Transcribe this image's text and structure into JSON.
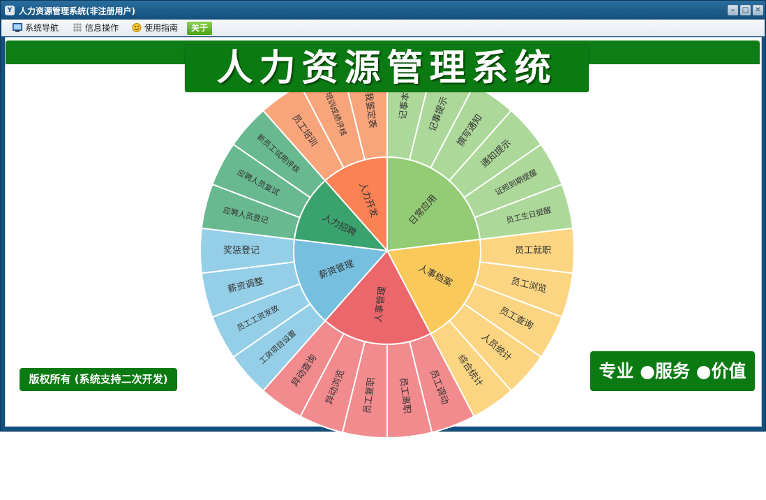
{
  "window": {
    "title": "人力资源管理系统(非注册用户)",
    "app_icon": "Y",
    "controls": {
      "minimize": "–",
      "maximize": "□",
      "close": "✕"
    }
  },
  "menu": {
    "items": [
      {
        "label": "系统导航",
        "icon": "monitor-icon"
      },
      {
        "label": "信息操作",
        "icon": "grid-icon"
      },
      {
        "label": "使用指南",
        "icon": "smiley-icon"
      },
      {
        "label": "关于",
        "icon": ""
      }
    ]
  },
  "banner": {
    "title": "人力资源管理系统"
  },
  "footer": {
    "copyright": "版权所有 (系统支持二次开发)",
    "slogan": "专业 ●服务 ●价值"
  },
  "colors": {
    "titlebar": "#14507d",
    "accent_green": "#0c7a12"
  },
  "wheel": {
    "categories": [
      {
        "label": "日常应用",
        "color": "#93cc74",
        "outer_color": "#acd899",
        "items": [
          "记事本",
          "记事提示",
          "撰写通知",
          "通知提示",
          "证照到期提醒",
          "员工生日提醒"
        ]
      },
      {
        "label": "人事档案",
        "color": "#f9c95b",
        "outer_color": "#fbd582",
        "items": [
          "员工就职",
          "员工浏览",
          "员工查询",
          "人员统计",
          "综合统计"
        ]
      },
      {
        "label": "人事管理",
        "color": "#ec676b",
        "outer_color": "#f28b8e",
        "items": [
          "员工调动",
          "员工离职",
          "员工复职",
          "异动浏览",
          "异动查询"
        ]
      },
      {
        "label": "薪资管理",
        "color": "#76bfdf",
        "outer_color": "#95cfe7",
        "items": [
          "工资项目设置",
          "员工工资发放",
          "薪资调整",
          "奖惩登记"
        ]
      },
      {
        "label": "人力招聘",
        "color": "#3aa36d",
        "outer_color": "#68b890",
        "items": [
          "应聘人员登记",
          "应聘人员复试",
          "新员工试用评核"
        ]
      },
      {
        "label": "人力开发",
        "color": "#fb8254",
        "outer_color": "#f9a57c",
        "items": [
          "员工培训",
          "培训成绩评核",
          "自我鉴定表"
        ]
      }
    ]
  }
}
